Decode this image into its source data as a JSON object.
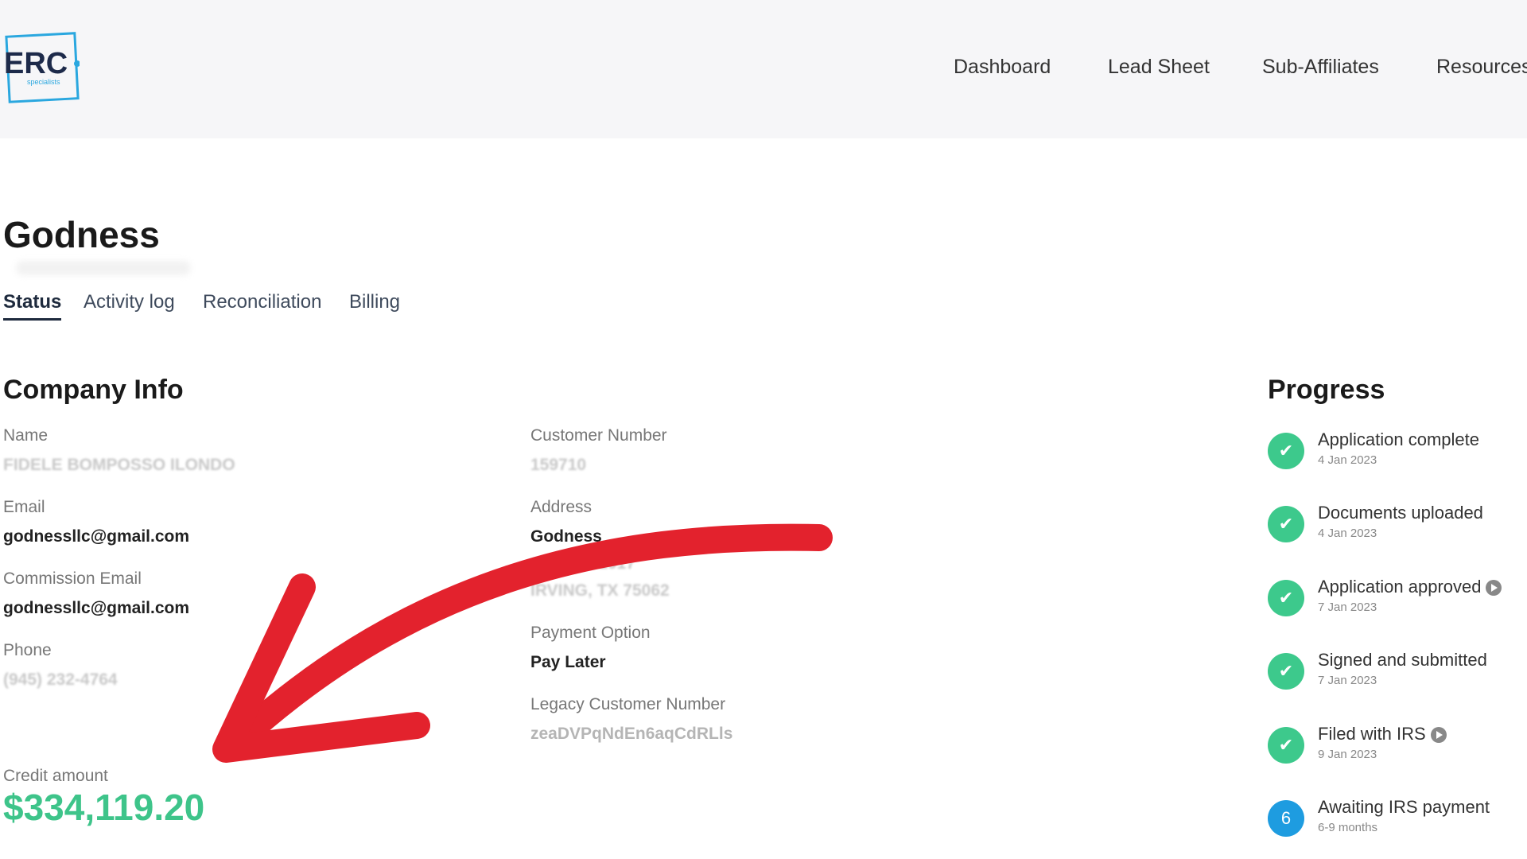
{
  "header": {
    "logo_text": "ERC",
    "logo_sub": "specialists",
    "nav": [
      "Dashboard",
      "Lead Sheet",
      "Sub-Affiliates",
      "Resources"
    ]
  },
  "page": {
    "title": "Godness",
    "tabs": [
      "Status",
      "Activity log",
      "Reconciliation",
      "Billing"
    ],
    "active_tab": "Status"
  },
  "company_info": {
    "title": "Company Info",
    "name_label": "Name",
    "name_value": "FIDELE BOMPOSSO ILONDO",
    "email_label": "Email",
    "email_value": "godnessllc@gmail.com",
    "commission_email_label": "Commission Email",
    "commission_email_value": "godnessllc@gmail.com",
    "phone_label": "Phone",
    "phone_value": "(945) 232-4764",
    "customer_number_label": "Customer Number",
    "customer_number_value": "159710",
    "address_label": "Address",
    "address_line1": "Godness",
    "address_line2": "...elle rd 1017",
    "address_line3": "IRVING, TX 75062",
    "payment_option_label": "Payment Option",
    "payment_option_value": "Pay Later",
    "legacy_label": "Legacy Customer Number",
    "legacy_value": "zeaDVPqNdEn6aqCdRLls",
    "credit_label": "Credit amount",
    "credit_value": "$334,119.20"
  },
  "progress": {
    "title": "Progress",
    "steps": [
      {
        "label": "Application complete",
        "date": "4 Jan 2023",
        "status": "done"
      },
      {
        "label": "Documents uploaded",
        "date": "4 Jan 2023",
        "status": "done"
      },
      {
        "label": "Application approved",
        "date": "7 Jan 2023",
        "status": "done"
      },
      {
        "label": "Signed and submitted",
        "date": "7 Jan 2023",
        "status": "done"
      },
      {
        "label": "Filed with IRS",
        "date": "9 Jan 2023",
        "status": "done"
      },
      {
        "label": "Awaiting IRS payment",
        "date": "6-9 months",
        "status": "current",
        "number": "6"
      }
    ]
  },
  "colors": {
    "accent_green": "#3ec48a",
    "step_green": "#3dc98c",
    "step_blue": "#1e9ce0",
    "arrow_red": "#e3222d"
  }
}
